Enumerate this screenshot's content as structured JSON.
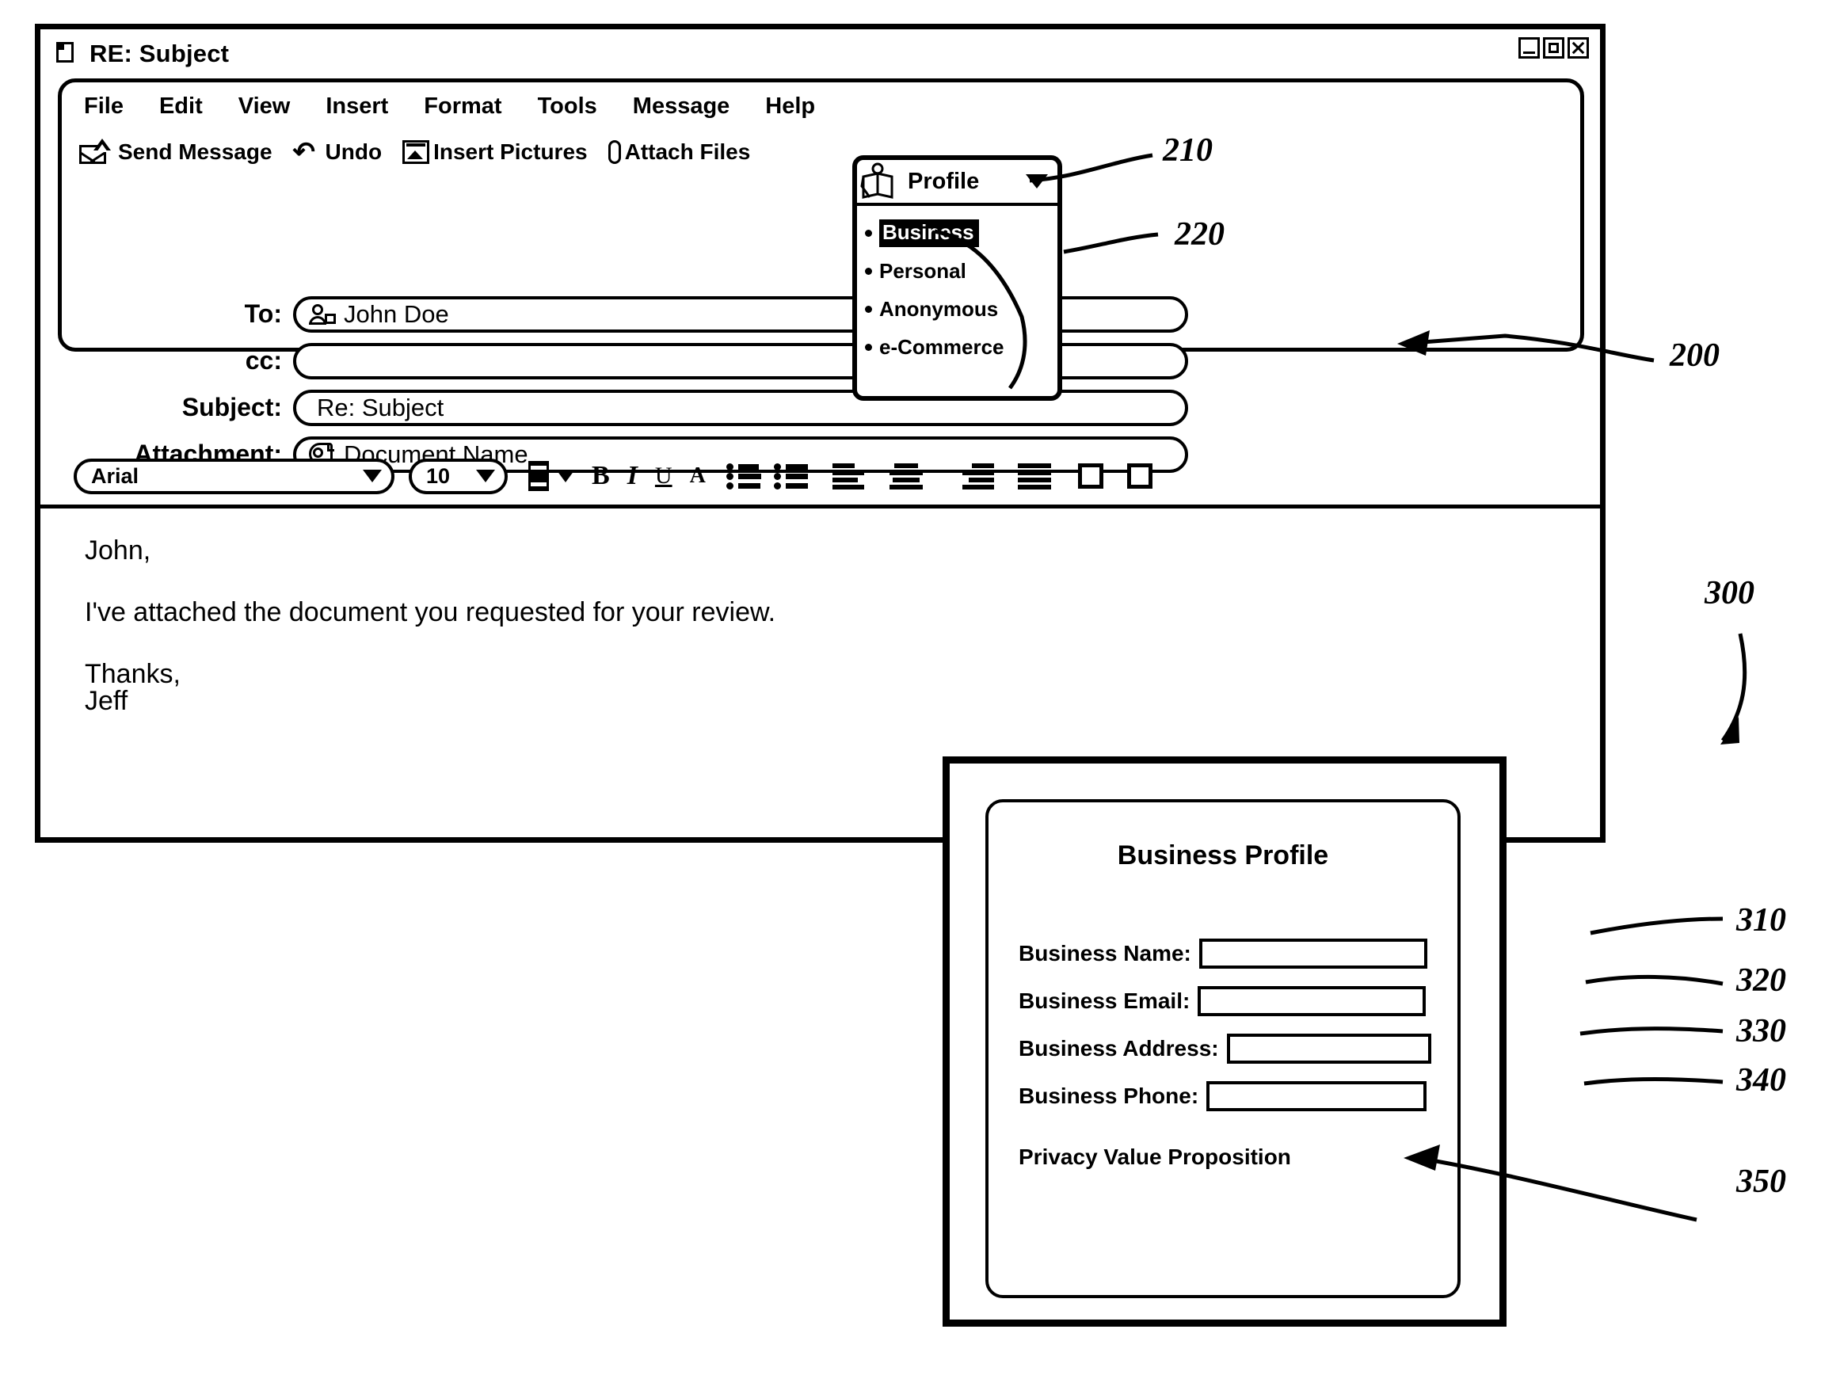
{
  "email_window": {
    "title": "RE: Subject",
    "doc_icon": "document-icon",
    "window_controls": [
      {
        "name": "minimize-button",
        "glyph": "minimize-icon"
      },
      {
        "name": "maximize-button",
        "glyph": "maximize-icon"
      },
      {
        "name": "close-button",
        "glyph": "close-icon"
      }
    ],
    "menu": [
      "File",
      "Edit",
      "View",
      "Insert",
      "Format",
      "Tools",
      "Message",
      "Help"
    ],
    "toolbar": [
      {
        "label": "Send Message",
        "icon": "envelope-send-icon"
      },
      {
        "label": "Undo",
        "icon": "undo-arrow-icon"
      },
      {
        "label": "Insert Pictures",
        "icon": "picture-icon"
      },
      {
        "label": "Attach Files",
        "icon": "paperclip-icon"
      }
    ],
    "profile_button": {
      "label": "Profile",
      "icon": "open-book-person-icon",
      "caret": "chevron-down-icon"
    },
    "profile_options": [
      {
        "label": "Business",
        "selected": true
      },
      {
        "label": "Personal",
        "selected": false
      },
      {
        "label": "Anonymous",
        "selected": false
      },
      {
        "label": "e-Commerce",
        "selected": false
      }
    ],
    "fields": [
      {
        "label": "To:",
        "value": "John Doe",
        "icon": "contact-card-icon"
      },
      {
        "label": "cc:",
        "value": "",
        "icon": ""
      },
      {
        "label": "Subject:",
        "value": "Re:  Subject",
        "icon": ""
      },
      {
        "label": "Attachment:",
        "value": "Document Name",
        "icon": "attachment-document-icon"
      }
    ],
    "format_bar": {
      "font_name": "Arial",
      "font_size": "10",
      "bold": "B",
      "italic": "I",
      "underline": "U",
      "font_color": "A",
      "color_swatch_hex": "#000000",
      "buttons": [
        "bulleted-list-icon",
        "numbered-list-icon",
        "align-left-icon",
        "align-center-icon",
        "align-right-icon",
        "align-justify-icon",
        "outdent-box-icon",
        "indent-box-icon"
      ]
    },
    "body": {
      "line1": "John,",
      "line2": "I've attached the document you requested for your review.",
      "line3": "Thanks,",
      "line4": "Jeff"
    }
  },
  "business_profile_dialog": {
    "title": "Business Profile",
    "fields": [
      {
        "label": "Business Name:",
        "value": ""
      },
      {
        "label": "Business Email:",
        "value": ""
      },
      {
        "label": "Business Address:",
        "value": ""
      },
      {
        "label": "Business Phone:",
        "value": ""
      }
    ],
    "privacy_text": "Privacy Value Proposition"
  },
  "reference_numbers": {
    "n200": "200",
    "n210": "210",
    "n220": "220",
    "n300": "300",
    "n310": "310",
    "n320": "320",
    "n330": "330",
    "n340": "340",
    "n350": "350"
  }
}
